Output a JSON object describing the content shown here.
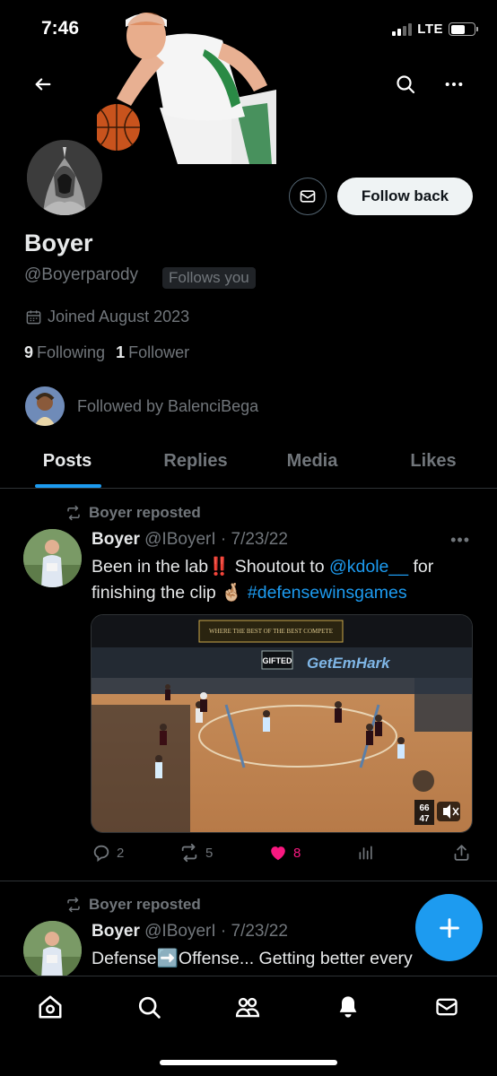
{
  "status_bar": {
    "time": "7:46",
    "network": "LTE"
  },
  "profile": {
    "display_name": "Boyer",
    "handle": "@Boyerparody",
    "follows_you": "Follows you",
    "joined": "Joined August 2023",
    "following_count": "9",
    "following_label": "Following",
    "follower_count": "1",
    "follower_label": "Follower",
    "followed_by": "Followed by BalenciBega",
    "follow_back_label": "Follow back"
  },
  "tabs": [
    {
      "label": "Posts",
      "active": true
    },
    {
      "label": "Replies",
      "active": false
    },
    {
      "label": "Media",
      "active": false
    },
    {
      "label": "Likes",
      "active": false
    }
  ],
  "posts": [
    {
      "repost_label": "Boyer reposted",
      "author": "Boyer",
      "meta": "@IBoyerI · 7/23/22",
      "text_part1": "Been in the lab",
      "emoji1": "‼️",
      "text_part2": " Shoutout to ",
      "mention": "@kdole__",
      "text_part3": " for",
      "text_line2": "finishing the clip ",
      "emoji2": "🤞🏼",
      "hashtag": "#defensewinsgames",
      "media_banner": "WHERE THE BEST OF THE BEST COMPETE",
      "media_sign": "GetEmHark",
      "media_logo": "GIFTED",
      "media_score_a": "66",
      "media_score_b": "47",
      "replies": "2",
      "reposts": "5",
      "likes": "8"
    },
    {
      "repost_label": "Boyer reposted",
      "author": "Boyer",
      "meta": "@IBoyerI · 7/23/22",
      "text": "Defense",
      "emoji": "➡️",
      "text2": "Offense... Getting better every"
    }
  ],
  "colors": {
    "accent": "#1d9bf0",
    "like": "#f91880",
    "muted": "#71767b"
  },
  "icons": [
    "back-arrow-icon",
    "search-icon",
    "more-icon",
    "mail-icon",
    "calendar-icon",
    "repost-icon",
    "reply-icon",
    "like-icon",
    "views-icon",
    "share-icon",
    "plus-icon",
    "home-icon",
    "communities-icon",
    "notifications-icon"
  ]
}
